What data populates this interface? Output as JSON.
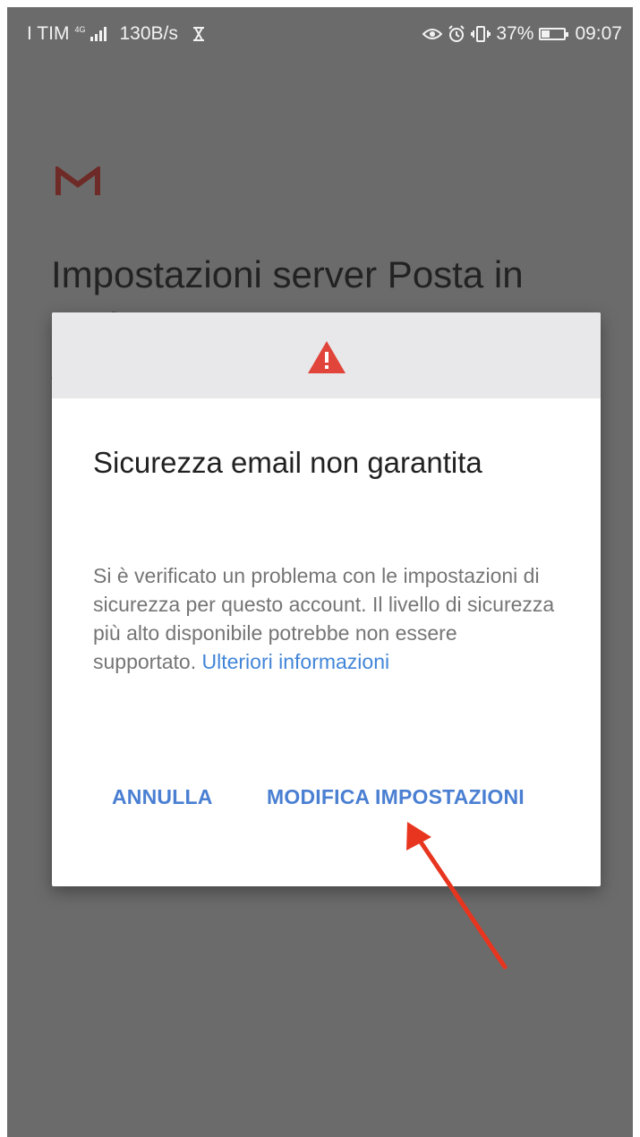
{
  "status_bar": {
    "carrier": "I TIM",
    "network_type": "4G",
    "speed": "130B/s",
    "battery_percent": "37%",
    "battery_level": 0.37,
    "time": "09:07",
    "icons": [
      "signal-icon",
      "hourglass-icon",
      "eye-icon",
      "alarm-icon",
      "vibrate-icon",
      "battery-icon"
    ]
  },
  "background_page": {
    "app_logo": "gmail-logo",
    "title": "Impostazioni server Posta in uscita"
  },
  "dialog": {
    "header_icon": "warning-icon",
    "header_icon_color": "#e0443a",
    "title": "Sicurezza email non garantita",
    "body": "Si è verificato un problema con le impostazioni di sicurezza per questo account. Il livello di sicurezza più alto disponibile potrebbe non essere supportato.",
    "link_label": "Ulteriori informazioni",
    "cancel_label": "ANNULLA",
    "modify_label": "MODIFICA IMPOSTAZIONI",
    "button_color": "#4a7fd2"
  },
  "annotation": {
    "arrow_color": "#e8351f"
  }
}
